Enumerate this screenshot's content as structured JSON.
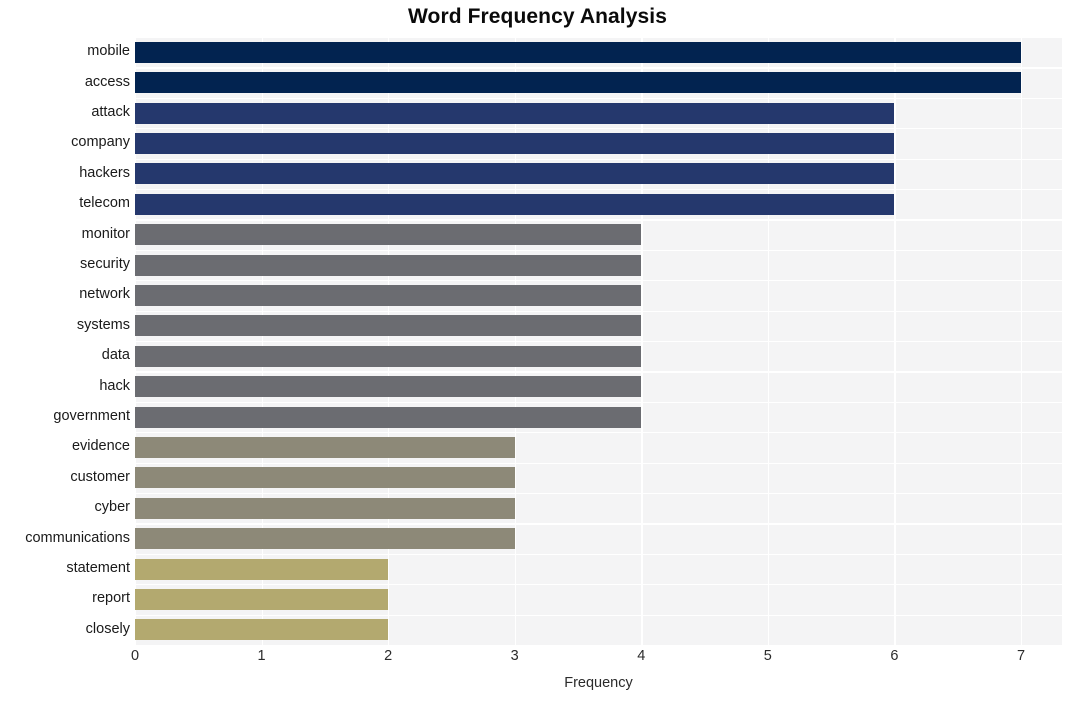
{
  "chart_data": {
    "type": "bar",
    "orientation": "horizontal",
    "title": "Word Frequency Analysis",
    "xlabel": "Frequency",
    "ylabel": "",
    "xlim": [
      0,
      7
    ],
    "xticks": [
      "0",
      "1",
      "2",
      "3",
      "4",
      "5",
      "6",
      "7"
    ],
    "grid": true,
    "legend": "none",
    "categories": [
      "mobile",
      "access",
      "attack",
      "company",
      "hackers",
      "telecom",
      "monitor",
      "security",
      "network",
      "systems",
      "data",
      "hack",
      "government",
      "evidence",
      "customer",
      "cyber",
      "communications",
      "statement",
      "report",
      "closely"
    ],
    "values": [
      7,
      7,
      6,
      6,
      6,
      6,
      4,
      4,
      4,
      4,
      4,
      4,
      4,
      3,
      3,
      3,
      3,
      2,
      2,
      2
    ],
    "bar_colors": [
      "#022350",
      "#022350",
      "#25386d",
      "#25386d",
      "#25386d",
      "#25386d",
      "#6b6c71",
      "#6b6c71",
      "#6b6c71",
      "#6b6c71",
      "#6b6c71",
      "#6b6c71",
      "#6b6c71",
      "#8d8978",
      "#8d8978",
      "#8d8978",
      "#8d8978",
      "#b3a96f",
      "#b3a96f",
      "#b3a96f"
    ],
    "plot_background": "#f4f4f5",
    "grid_color": "#ffffff",
    "figure_background": "#ffffff"
  }
}
